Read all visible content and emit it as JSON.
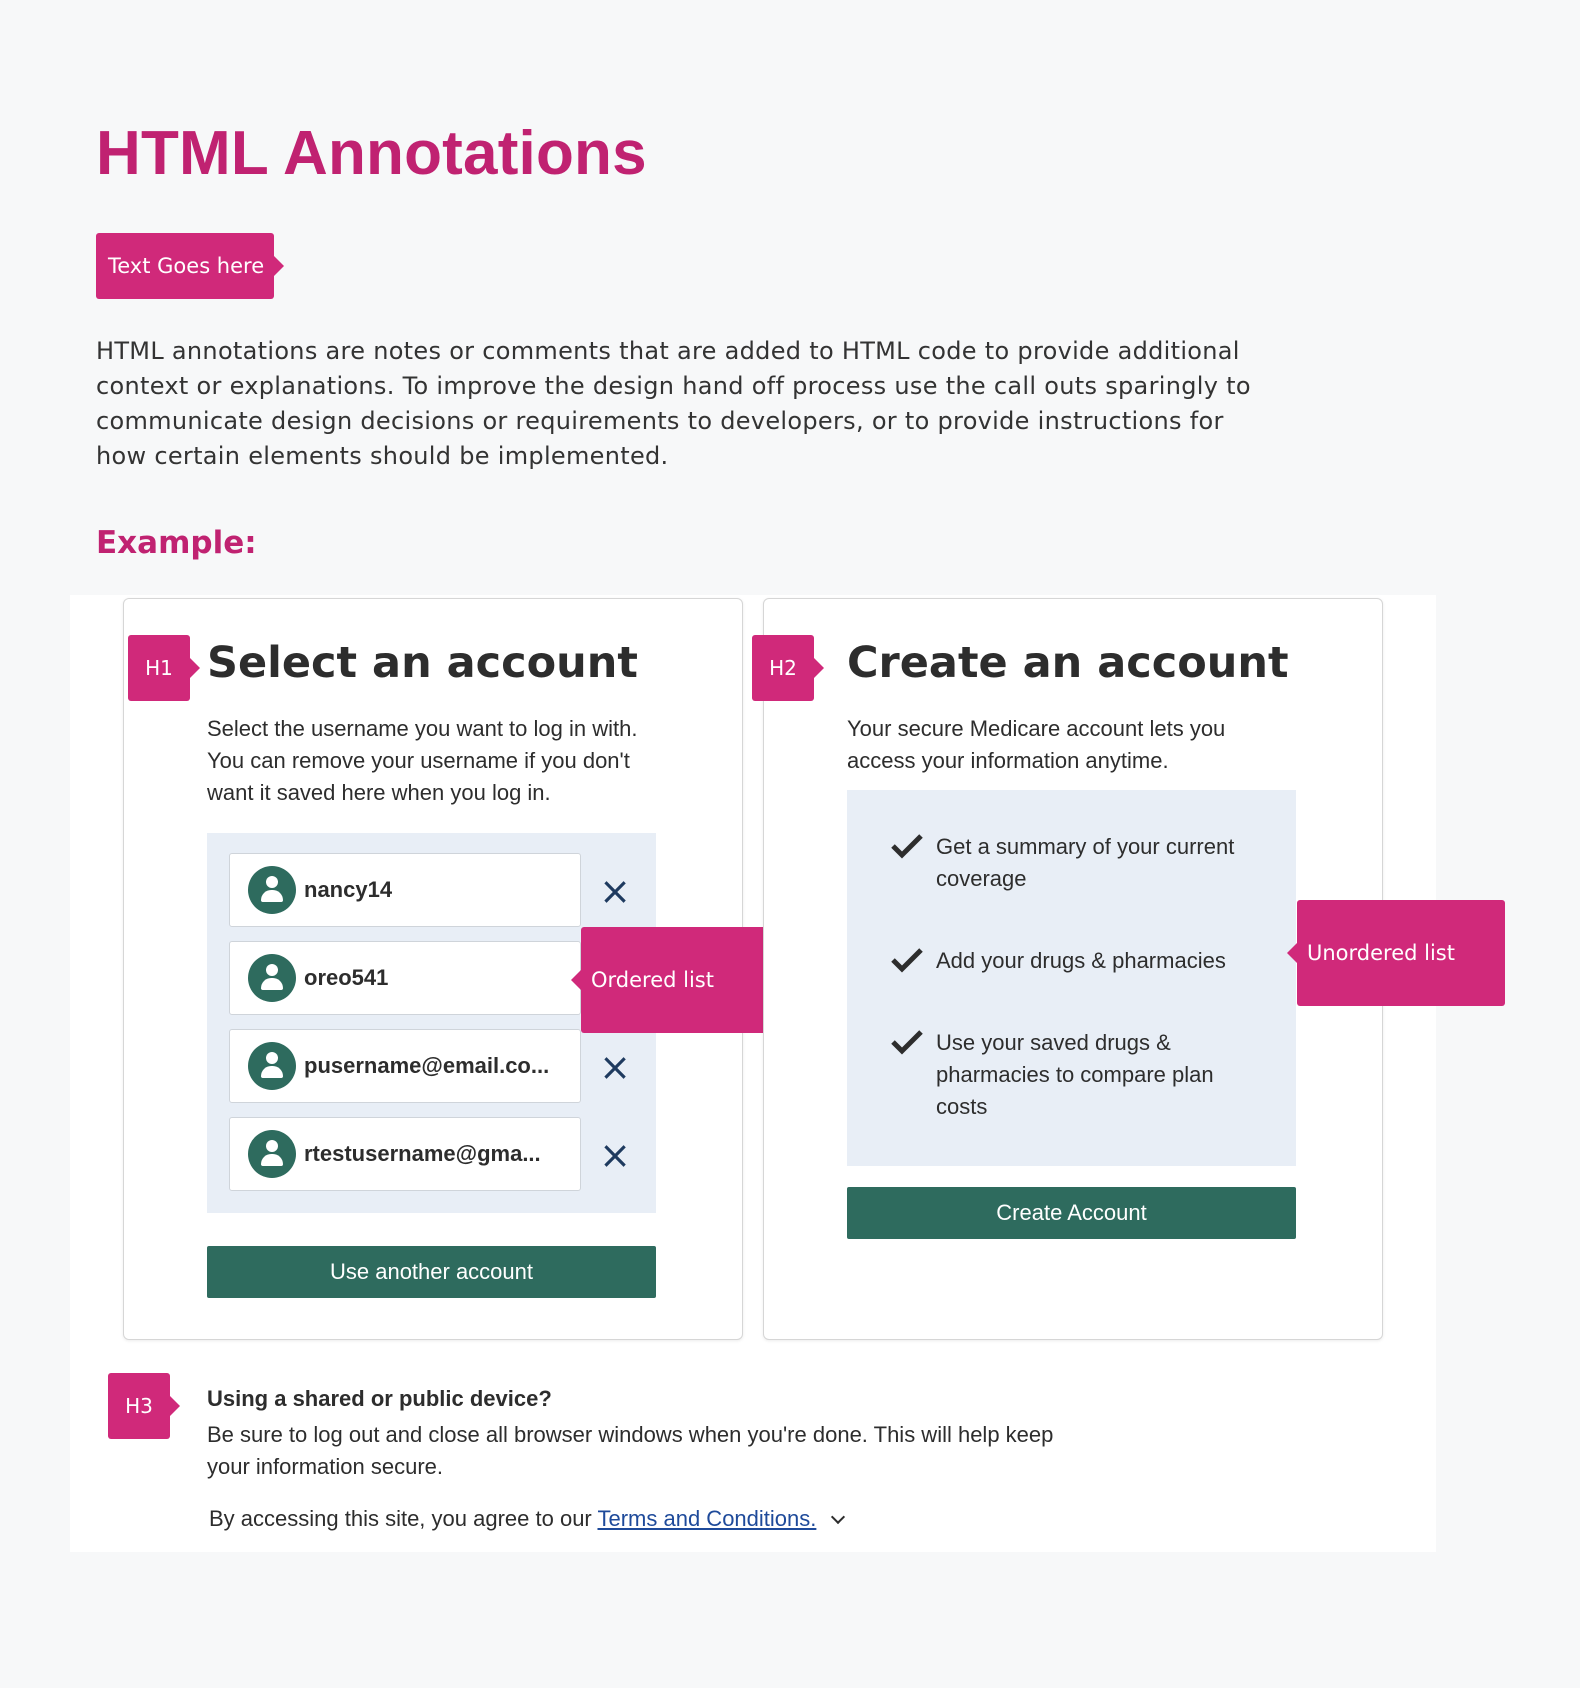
{
  "page": {
    "title": "HTML Annotations",
    "text_tag": "Text Goes here",
    "intro": "HTML annotations are notes or comments that are added to HTML code to provide additional context or explanations. To improve the design hand off process use the call outs sparingly to communicate design decisions or requirements to developers, or to provide instructions for how certain elements should be implemented.",
    "example_heading": "Example:"
  },
  "select_card": {
    "tag": "H1",
    "title": "Select an account",
    "description": "Select the username you want to log in with. You can remove your username if you don't want it saved here when you log in.",
    "accounts": [
      {
        "name": "nancy14",
        "removable": true
      },
      {
        "name": "oreo541",
        "removable": false
      },
      {
        "name": "pusername@email.co...",
        "removable": true
      },
      {
        "name": "rtestusername@gma...",
        "removable": true
      }
    ],
    "remove_icon": "×",
    "callout": "Ordered list",
    "button": "Use another account"
  },
  "create_card": {
    "tag": "H2",
    "title": "Create an account",
    "description": "Your secure Medicare account lets you access your information anytime.",
    "benefits": [
      "Get a summary of your current coverage",
      "Add your drugs & pharmacies",
      "Use your saved drugs & pharmacies to compare plan costs"
    ],
    "callout": "Unordered list",
    "button": "Create Account"
  },
  "footer": {
    "tag": "H3",
    "heading": "Using a shared or public device?",
    "text": "Be sure to log out and close all browser windows when you're done. This will help keep your information secure.",
    "terms_prefix": "By accessing this site, you agree to our",
    "terms_link": "Terms and Conditions."
  },
  "colors": {
    "accent": "#c02271",
    "tag": "#d0297a",
    "button": "#2e6b5e",
    "panel": "#e8eef6"
  }
}
